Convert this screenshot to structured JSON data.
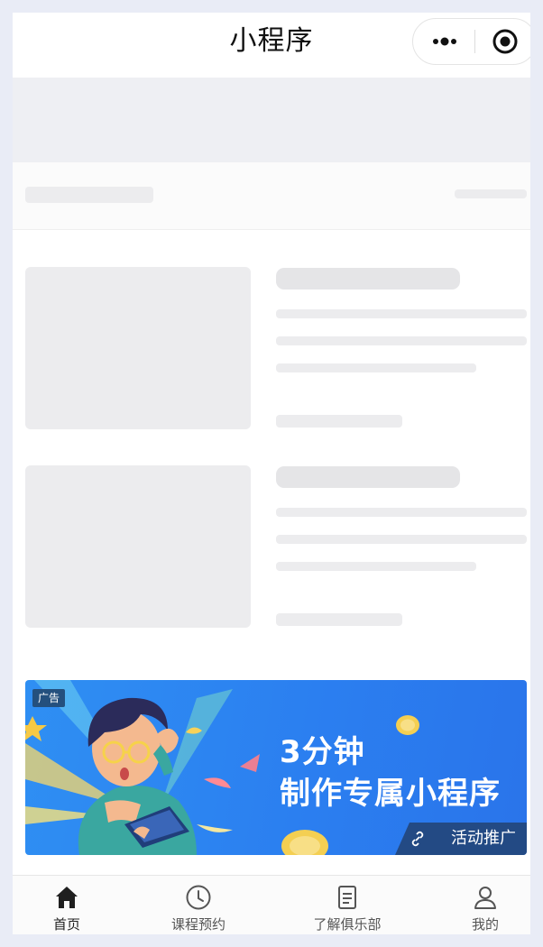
{
  "navbar": {
    "title": "小程序",
    "more_icon": "more-dots-icon",
    "close_icon": "target-close-icon"
  },
  "ad": {
    "tag": "广告",
    "headline_1": "3分钟",
    "headline_2": "制作专属小程序",
    "promo_label": "活动推广",
    "accent_color": "#2f8ff3"
  },
  "tabbar": {
    "items": [
      {
        "label": "首页",
        "icon": "home-icon",
        "active": true
      },
      {
        "label": "课程预约",
        "icon": "clock-icon",
        "active": false
      },
      {
        "label": "了解俱乐部",
        "icon": "document-icon",
        "active": false
      },
      {
        "label": "我的",
        "icon": "user-icon",
        "active": false
      }
    ]
  }
}
